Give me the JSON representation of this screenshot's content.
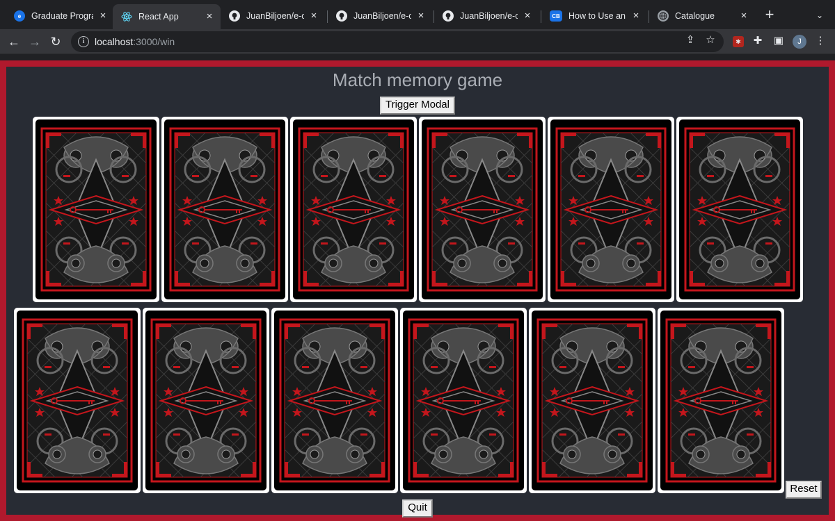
{
  "browser": {
    "tabs": [
      {
        "title": "Graduate Program",
        "icon": "edge-favicon-icon",
        "active": false
      },
      {
        "title": "React App",
        "icon": "react-favicon-icon",
        "active": true
      },
      {
        "title": "JuanBiljoen/e-con",
        "icon": "github-favicon-icon",
        "active": false
      },
      {
        "title": "JuanBiljoen/e-con",
        "icon": "github-favicon-icon",
        "active": false
      },
      {
        "title": "JuanBiljoen/e-con",
        "icon": "github-favicon-icon",
        "active": false
      },
      {
        "title": "How to Use an Im",
        "icon": "cb-favicon-icon",
        "active": false
      },
      {
        "title": "Catalogue",
        "icon": "globe-favicon-icon",
        "active": false
      }
    ],
    "cb_favicon_text": "CB",
    "address": {
      "host": "localhost",
      "path": ":3000/win"
    },
    "profile_initial": "J"
  },
  "page": {
    "title": "Match memory game",
    "trigger_modal_label": "Trigger Modal",
    "reset_label": "Reset",
    "quit_label": "Quit"
  },
  "cards": {
    "row_1_count": 6,
    "row_2_count": 6,
    "state": "face-down"
  },
  "colors": {
    "page_border": "#b0192d",
    "page_background": "#282c34",
    "title_text": "#a9adb4",
    "card_back_accent": "#c4161c"
  }
}
